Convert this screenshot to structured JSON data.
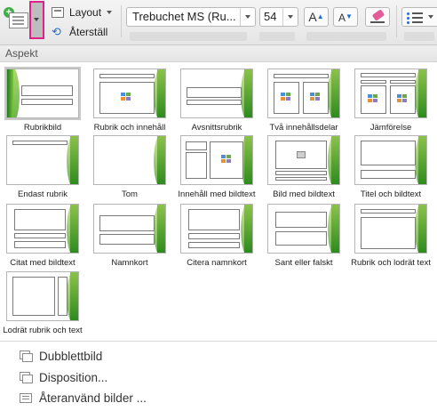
{
  "toolbar": {
    "layout_label": "Layout",
    "reset_label": "Återställ",
    "font_name": "Trebuchet MS (Ru...",
    "font_size": "54",
    "grow_font_label": "A",
    "shrink_font_label": "A",
    "icons": [
      "new-slide-icon",
      "layout-icon",
      "reset-icon",
      "clear-formatting-icon",
      "bullets-icon"
    ]
  },
  "section_title": "Aspekt",
  "layouts": [
    {
      "label": "Rubrikbild"
    },
    {
      "label": "Rubrik och innehåll"
    },
    {
      "label": "Avsnittsrubrik"
    },
    {
      "label": "Två innehållsdelar"
    },
    {
      "label": "Jämförelse"
    },
    {
      "label": "Endast rubrik"
    },
    {
      "label": "Tom"
    },
    {
      "label": "Innehåll med bildtext"
    },
    {
      "label": "Bild med bildtext"
    },
    {
      "label": "Titel och bildtext"
    },
    {
      "label": "Citat med bildtext"
    },
    {
      "label": "Namnkort"
    },
    {
      "label": "Citera namnkort"
    },
    {
      "label": "Sant eller falskt"
    },
    {
      "label": "Rubrik och lodrät text"
    },
    {
      "label": "Lodrät rubrik och text"
    }
  ],
  "menu": {
    "duplicate": "Dubblettbild",
    "outline": "Disposition...",
    "reuse": "Återanvänd bilder ..."
  },
  "colors": {
    "highlight": "#e0218a",
    "theme_green": "#4aa52a"
  }
}
